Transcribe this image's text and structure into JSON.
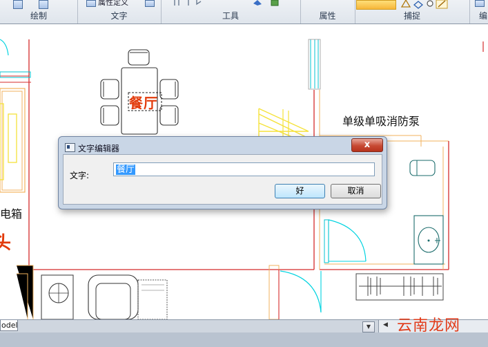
{
  "ribbon": {
    "groups": {
      "draw": "绘制",
      "text": "文字",
      "tools": "工具",
      "properties": "属性",
      "snap": "捕捉",
      "edit_partial": "编"
    },
    "attr_define_label": "属性定义"
  },
  "drawing": {
    "room_label": "餐厅",
    "pump_label": "单级单吸消防泵",
    "left_label_partial": "电箱",
    "left_red_partial": "头"
  },
  "dialog": {
    "title": "文字编辑器",
    "close_label": "x",
    "text_label": "文字:",
    "text_value": "餐厅",
    "ok_label": "好",
    "cancel_label": "取消"
  },
  "statusbar": {
    "model_tab": "odel",
    "watermark": "云南龙网"
  },
  "colors": {
    "wall_red": "#d42a2a",
    "wall_orange": "#f2b25c",
    "cyan": "#00d3e0",
    "yellow": "#f5e23a",
    "label_red": "#e23a0a",
    "dialog_frame": "#c9d6e6"
  }
}
